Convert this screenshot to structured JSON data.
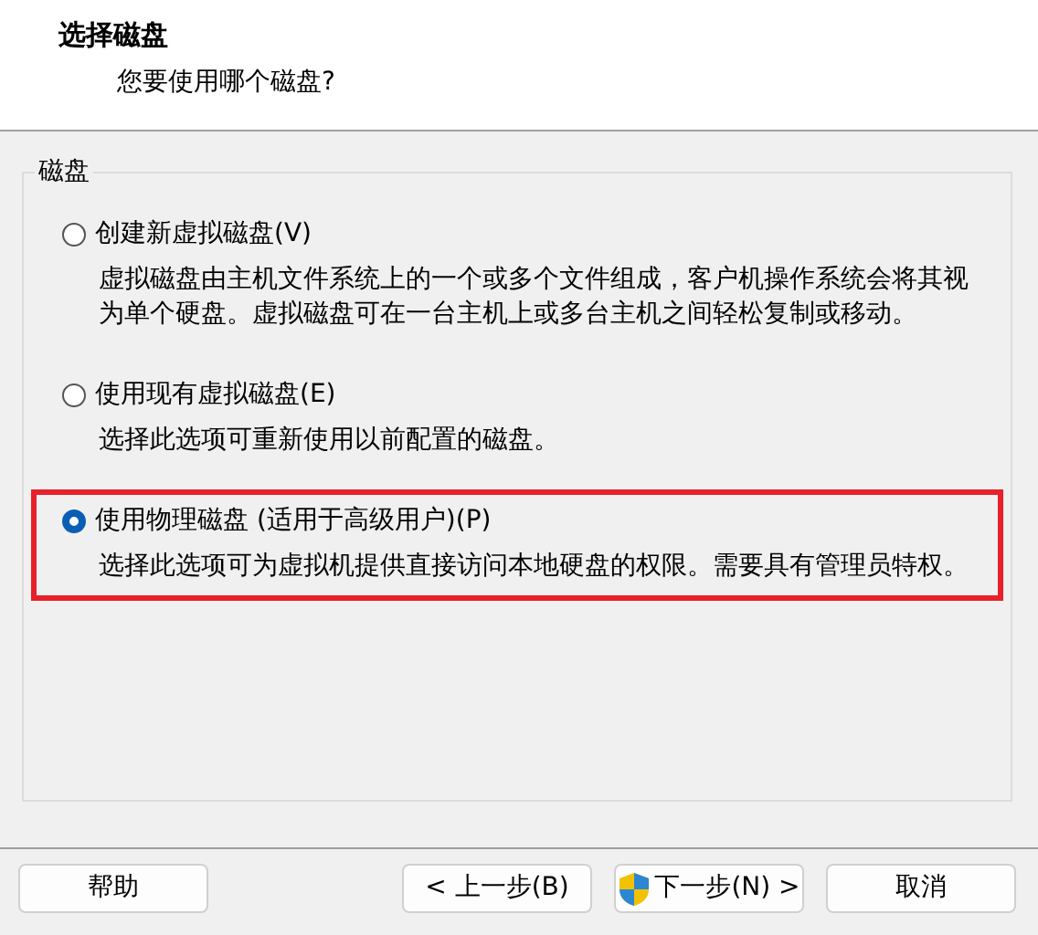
{
  "header": {
    "title": "选择磁盘",
    "subtitle": "您要使用哪个磁盘?"
  },
  "group": {
    "label": "磁盘",
    "options": [
      {
        "label": "创建新虚拟磁盘(V)",
        "description": "虚拟磁盘由主机文件系统上的一个或多个文件组成，客户机操作系统会将其视为单个硬盘。虚拟磁盘可在一台主机上或多台主机之间轻松复制或移动。",
        "selected": false,
        "highlighted": false
      },
      {
        "label": "使用现有虚拟磁盘(E)",
        "description": "选择此选项可重新使用以前配置的磁盘。",
        "selected": false,
        "highlighted": false
      },
      {
        "label": "使用物理磁盘 (适用于高级用户)(P)",
        "description": "选择此选项可为虚拟机提供直接访问本地硬盘的权限。需要具有管理员特权。",
        "selected": true,
        "highlighted": true
      }
    ]
  },
  "buttons": [
    {
      "label": "帮助",
      "kind": "help"
    },
    {
      "label": "< 上一步(B)",
      "kind": "back"
    },
    {
      "label": "下一步(N) >",
      "kind": "next",
      "shield": true
    },
    {
      "label": "取消",
      "kind": "cancel"
    }
  ]
}
